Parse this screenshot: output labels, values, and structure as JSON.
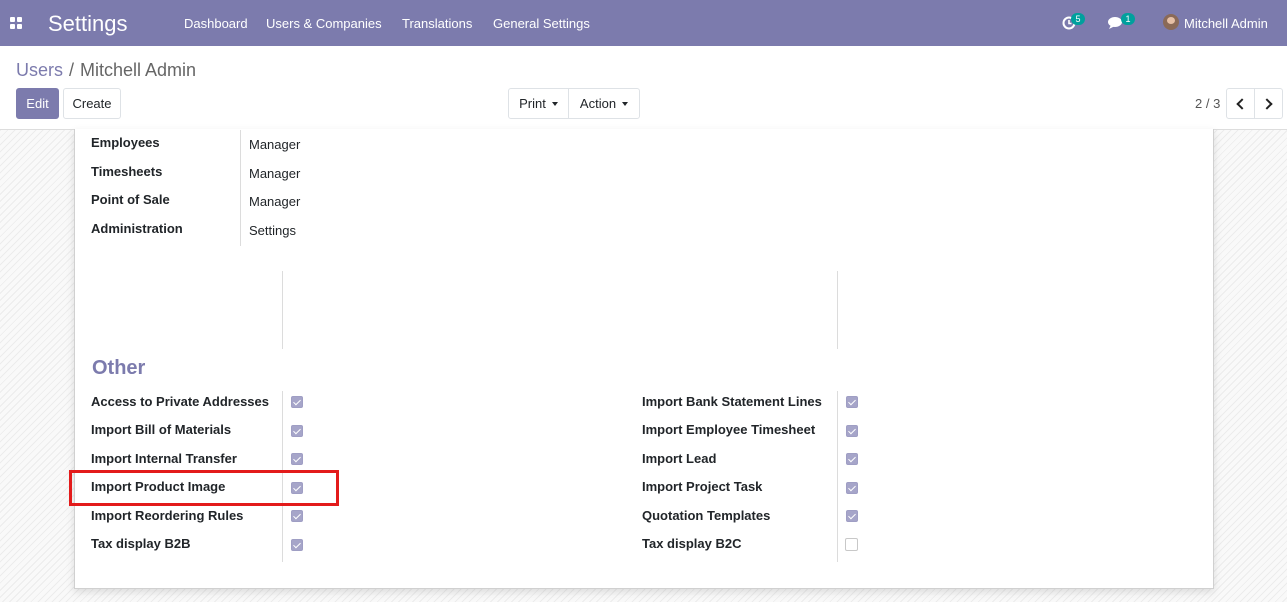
{
  "navbar": {
    "app_title": "Settings",
    "menu": [
      "Dashboard",
      "Users & Companies",
      "Translations",
      "General Settings"
    ],
    "activity_count": "5",
    "messages_count": "1",
    "user_name": "Mitchell Admin"
  },
  "breadcrumb": {
    "parent": "Users",
    "separator": "/",
    "current": "Mitchell Admin"
  },
  "buttons": {
    "edit": "Edit",
    "create": "Create",
    "print": "Print",
    "action": "Action"
  },
  "pager": {
    "value": "2 / 3"
  },
  "access_rights": [
    {
      "label": "Employees",
      "value": "Manager"
    },
    {
      "label": "Timesheets",
      "value": "Manager"
    },
    {
      "label": "Point of Sale",
      "value": "Manager"
    },
    {
      "label": "Administration",
      "value": "Settings"
    }
  ],
  "other": {
    "title": "Other",
    "left": [
      {
        "label": "Access to Private Addresses",
        "checked": true
      },
      {
        "label": "Import Bill of Materials",
        "checked": true
      },
      {
        "label": "Import Internal Transfer",
        "checked": true
      },
      {
        "label": "Import Product Image",
        "checked": true
      },
      {
        "label": "Import Reordering Rules",
        "checked": true
      },
      {
        "label": "Tax display B2B",
        "checked": true
      }
    ],
    "right": [
      {
        "label": "Import Bank Statement Lines",
        "checked": true
      },
      {
        "label": "Import Employee Timesheet",
        "checked": true
      },
      {
        "label": "Import Lead",
        "checked": true
      },
      {
        "label": "Import Project Task",
        "checked": true
      },
      {
        "label": "Quotation Templates",
        "checked": true
      },
      {
        "label": "Tax display B2C",
        "checked": false
      }
    ]
  },
  "colors": {
    "brand": "#7c7bad",
    "badge": "#00a09d",
    "highlight": "#e31b1b"
  },
  "icons": [
    "apps-grid-icon",
    "activity-clock-icon",
    "messages-icon",
    "user-avatar",
    "chevron-left-icon",
    "chevron-right-icon",
    "checkbox-icon"
  ]
}
